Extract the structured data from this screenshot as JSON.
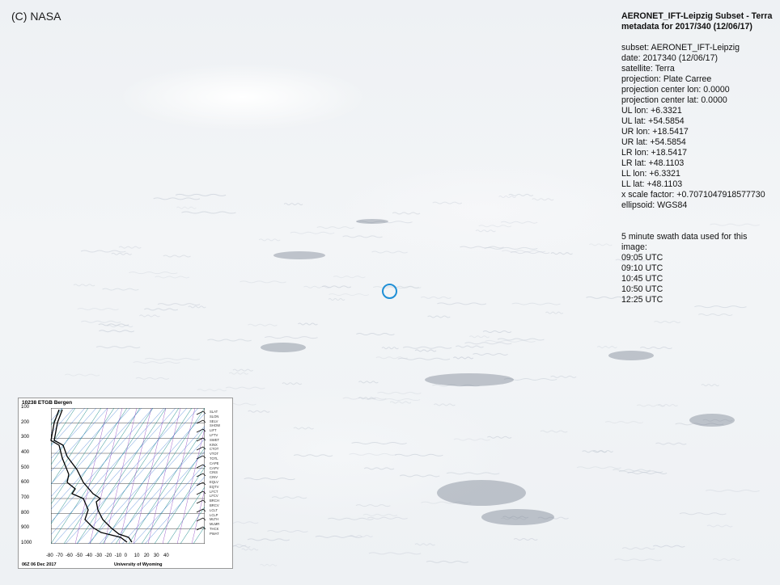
{
  "credit": "(C) NASA",
  "metadata": {
    "title_line1": "AERONET_IFT-Leipzig Subset - Terra",
    "title_line2": "metadata for 2017/340 (12/06/17)",
    "lines": [
      "subset: AERONET_IFT-Leipzig",
      "date: 2017340 (12/06/17)",
      "satellite: Terra",
      "projection: Plate Carree",
      "projection center lon: 0.0000",
      "projection center lat: 0.0000",
      "UL lon: +6.3321",
      "UL lat: +54.5854",
      "UR lon: +18.5417",
      "UR lat: +54.5854",
      "LR lon: +18.5417",
      "LR lat: +48.1103",
      "LL lon: +6.3321",
      "LL lat: +48.1103",
      "x scale factor: +0.7071047918577730",
      "ellipsoid: WGS84"
    ],
    "swath_heading_line1": "5 minute swath data used for this",
    "swath_heading_line2": "image:",
    "swath_times": [
      "09:05 UTC",
      "09:10 UTC",
      "10:45 UTC",
      "10:50 UTC",
      "12:25 UTC"
    ]
  },
  "sounding": {
    "title": "10238 ETGB Bergen",
    "footer_left": "06Z 06 Dec 2017",
    "footer_right": "University of Wyoming",
    "pressure_labels": [
      "100",
      "200",
      "300",
      "400",
      "500",
      "600",
      "700",
      "800",
      "900",
      "1000"
    ],
    "temp_labels": [
      "-80",
      "-70",
      "-60",
      "-50",
      "-40",
      "-30",
      "-20",
      "-10",
      "0",
      "10",
      "20",
      "30",
      "40"
    ],
    "indices": [
      "SLAT",
      "SLON",
      "SELV",
      "SHOW",
      "LIFT",
      "LFTV",
      "SWET",
      "KINX",
      "CTOT",
      "VTOT",
      "TOTL",
      "CAPE",
      "CAPV",
      "CINS",
      "CINV",
      "EQLV",
      "EQTV",
      "LFCT",
      "LFCV",
      "BRCH",
      "BRCV",
      "LCLT",
      "LCLP",
      "MLTH",
      "MLMR",
      "THCK",
      "PWAT"
    ],
    "colors": {
      "isotherm": "#1a8a8a",
      "dry_adiabat": "#2b6fd1",
      "moist_adiabat": "#8a3fbf",
      "profile": "#000000"
    }
  },
  "colors": {
    "marker": "#1f8fd6",
    "cloud_shadow": "#5b6778"
  }
}
